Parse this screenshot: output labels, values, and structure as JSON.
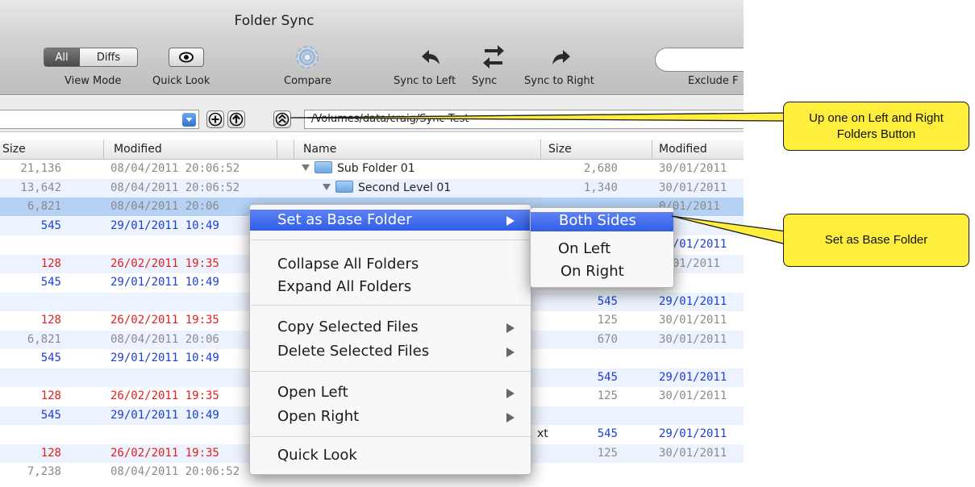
{
  "window": {
    "title": "Folder Sync"
  },
  "toolbar": {
    "view_mode": {
      "all": "All",
      "diffs": "Diffs",
      "label": "View Mode"
    },
    "quick_look_label": "Quick Look",
    "compare_label": "Compare",
    "sync_to_left_label": "Sync to Left",
    "sync_label": "Sync",
    "sync_to_right_label": "Sync to Right",
    "exclude_label": "Exclude F"
  },
  "path_bar": {
    "right_path": "/Volumes/data/craig/Sync Test"
  },
  "columns": {
    "left_size": "Size",
    "left_modified": "Modified",
    "name": "Name",
    "right_size": "Size",
    "right_modified": "Modified"
  },
  "rows": [
    {
      "ls": "21,136",
      "ld": "08/04/2011 20:06:52",
      "lc": "gray",
      "name": "Sub Folder 01",
      "indent": 0,
      "folder": true,
      "rs": "2,680",
      "rd": "30/01/2011",
      "rc": "gray"
    },
    {
      "ls": "13,642",
      "ld": "08/04/2011 20:06:52",
      "lc": "gray",
      "name": "Second Level 01",
      "indent": 1,
      "folder": true,
      "rs": "1,340",
      "rd": "30/01/2011",
      "rc": "gray"
    },
    {
      "ls": "6,821",
      "ld": "08/04/2011 20:06",
      "lc": "gray",
      "name": "",
      "rs": "",
      "rd": "0/01/2011",
      "rc": "gray"
    },
    {
      "ls": "545",
      "ld": "29/01/2011 10:49",
      "lc": "blue",
      "name": "",
      "rs": "",
      "rd": "",
      "rc": ""
    },
    {
      "ls": "",
      "ld": "",
      "lc": "",
      "name": "",
      "rs": "",
      "rd": "29/01/2011",
      "rc": "blue"
    },
    {
      "ls": "128",
      "ld": "26/02/2011 19:35",
      "lc": "red",
      "name": "",
      "rs": "",
      "rd": "0/01/2011",
      "rc": "gray"
    },
    {
      "ls": "545",
      "ld": "29/01/2011 10:49",
      "lc": "blue",
      "name": "",
      "rs": "",
      "rd": "",
      "rc": ""
    },
    {
      "ls": "",
      "ld": "",
      "lc": "",
      "name": "",
      "rs": "545",
      "rd": "29/01/2011",
      "rc": "blue"
    },
    {
      "ls": "128",
      "ld": "26/02/2011 19:35",
      "lc": "red",
      "name": "",
      "rs": "125",
      "rd": "30/01/2011",
      "rc": "gray"
    },
    {
      "ls": "6,821",
      "ld": "08/04/2011 20:06",
      "lc": "gray",
      "name": "",
      "rs": "670",
      "rd": "30/01/2011",
      "rc": "gray"
    },
    {
      "ls": "545",
      "ld": "29/01/2011 10:49",
      "lc": "blue",
      "name": "",
      "rs": "",
      "rd": "",
      "rc": ""
    },
    {
      "ls": "",
      "ld": "",
      "lc": "",
      "name": "",
      "rs": "545",
      "rd": "29/01/2011",
      "rc": "blue"
    },
    {
      "ls": "128",
      "ld": "26/02/2011 19:35",
      "lc": "red",
      "name": "",
      "rs": "125",
      "rd": "30/01/2011",
      "rc": "gray"
    },
    {
      "ls": "545",
      "ld": "29/01/2011 10:49",
      "lc": "blue",
      "name": "",
      "rs": "",
      "rd": "",
      "rc": ""
    },
    {
      "ls": "",
      "ld": "",
      "lc": "",
      "name": "xt",
      "rs": "545",
      "rd": "29/01/2011",
      "rc": "blue"
    },
    {
      "ls": "128",
      "ld": "26/02/2011 19:35",
      "lc": "red",
      "name": "",
      "rs": "125",
      "rd": "30/01/2011",
      "rc": "gray"
    },
    {
      "ls": "7,238",
      "ld": "08/04/2011 20:06:52",
      "lc": "gray",
      "name": "",
      "rs": "",
      "rd": "",
      "rc": ""
    }
  ],
  "context_menu": {
    "set_as_base_folder": "Set as Base Folder",
    "collapse_all_folders": "Collapse All Folders",
    "expand_all_folders": "Expand All Folders",
    "copy_selected_files": "Copy Selected Files",
    "delete_selected_files": "Delete Selected Files",
    "open_left": "Open Left",
    "open_right": "Open Right",
    "quick_look": "Quick Look"
  },
  "submenu": {
    "both_sides": "Both Sides",
    "on_left": "On Left",
    "on_right": "On Right"
  },
  "callouts": {
    "up_one": "Up one on Left and Right Folders Button",
    "set_base": "Set as Base Folder"
  },
  "colors": {
    "callout_fill": "#ffef3c",
    "menu_highlight": "#3a65ea",
    "blue_text": "#1a3ed8",
    "red_text": "#e0201e",
    "gray_text": "#8a8a8a"
  }
}
